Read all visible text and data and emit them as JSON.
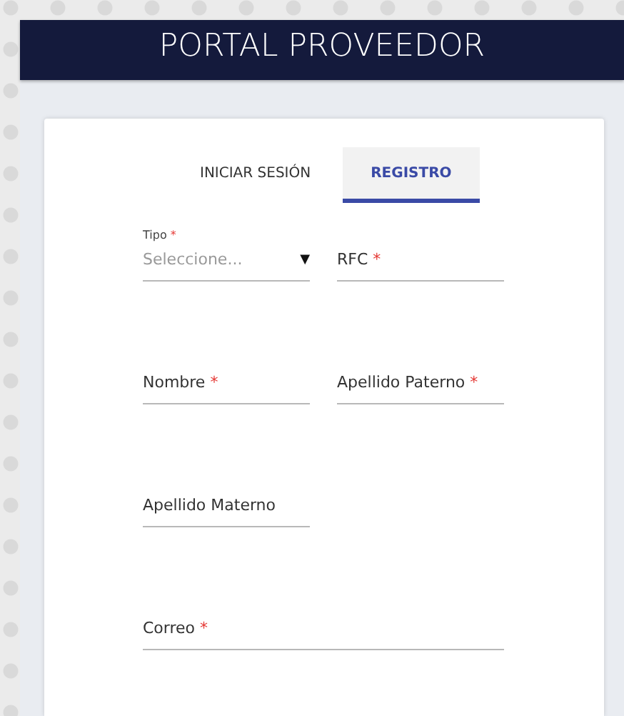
{
  "header": {
    "title": "PORTAL PROVEEDOR"
  },
  "tabs": [
    {
      "label": "INICIAR SESIÓN",
      "selected": false
    },
    {
      "label": "REGISTRO",
      "selected": true
    }
  ],
  "rows": [
    [
      {
        "kind": "select",
        "label": "Tipo",
        "required_mark": "*",
        "placeholder": "Seleccione...",
        "caret": "▼"
      },
      {
        "kind": "text",
        "label": "RFC",
        "required_mark": "*"
      }
    ],
    [
      {
        "kind": "text",
        "label": "Nombre",
        "required_mark": "*"
      },
      {
        "kind": "text",
        "label": "Apellido Paterno",
        "required_mark": "*"
      }
    ],
    [
      {
        "kind": "text",
        "label": "Apellido Materno"
      }
    ],
    [
      {
        "kind": "text",
        "label": "Correo",
        "required_mark": "*",
        "wide": true
      }
    ]
  ]
}
